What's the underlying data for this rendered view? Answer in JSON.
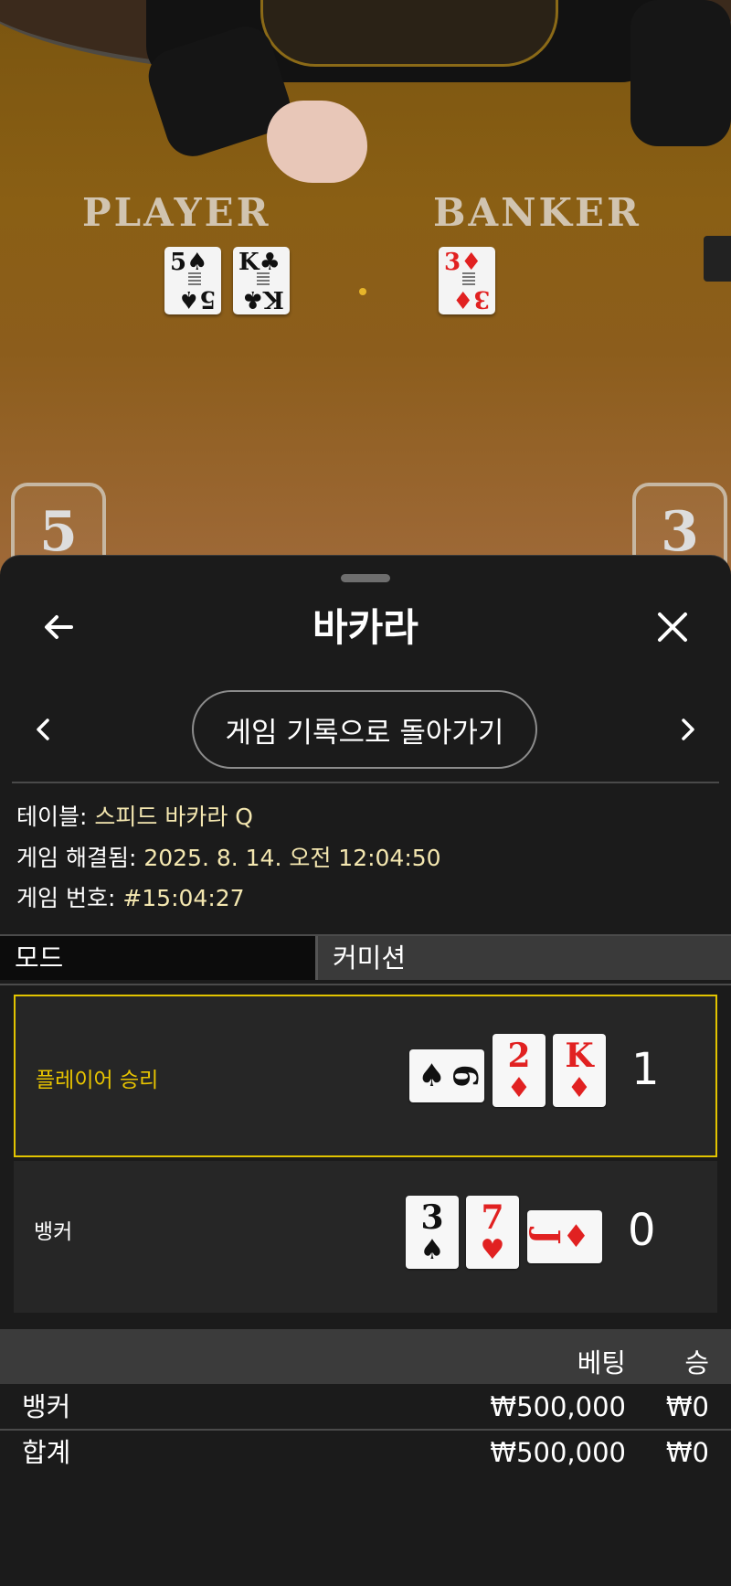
{
  "video": {
    "player_word": "PLAYER",
    "banker_word": "BANKER",
    "player_score": "5",
    "banker_score": "3",
    "player_cards": [
      {
        "rank": "5",
        "suit": "♠"
      },
      {
        "rank": "K",
        "suit": "♣"
      }
    ],
    "banker_cards": [
      {
        "rank": "3",
        "suit": "♦"
      }
    ]
  },
  "sheet": {
    "title": "바카라",
    "back_icon": "arrow-left-icon",
    "close_icon": "close-icon",
    "history_button": "게임 기록으로 돌아가기"
  },
  "info": {
    "table_label": "테이블: ",
    "table_value": "스피드 바카라 Q",
    "resolved_label": "게임 해결됨: ",
    "resolved_value": "2025. 8. 14. 오전 12:04:50",
    "game_no_label": "게임 번호: ",
    "game_no_value": "#15:04:27"
  },
  "mode": {
    "label": "모드",
    "value": "커미션"
  },
  "results": {
    "player": {
      "label": "플레이어 승리",
      "score": "1",
      "cards": [
        {
          "rank": "6",
          "suit": "♠",
          "sideways": true
        },
        {
          "rank": "2",
          "suit": "♦",
          "sideways": false
        },
        {
          "rank": "K",
          "suit": "♦",
          "sideways": false
        }
      ]
    },
    "banker": {
      "label": "뱅커",
      "score": "0",
      "cards": [
        {
          "rank": "3",
          "suit": "♠",
          "sideways": false
        },
        {
          "rank": "7",
          "suit": "♥",
          "sideways": false
        },
        {
          "rank": "J",
          "suit": "♦",
          "sideways": true
        }
      ]
    }
  },
  "bets": {
    "header_bet": "베팅",
    "header_win": "승",
    "rows": [
      {
        "name": "뱅커",
        "bet": "₩500,000",
        "win": "₩0"
      },
      {
        "name": "합계",
        "bet": "₩500,000",
        "win": "₩0"
      }
    ]
  },
  "colors": {
    "winner_border": "#e2c400",
    "winner_label": "#e8c400",
    "info_value": "#f4e7b0"
  }
}
